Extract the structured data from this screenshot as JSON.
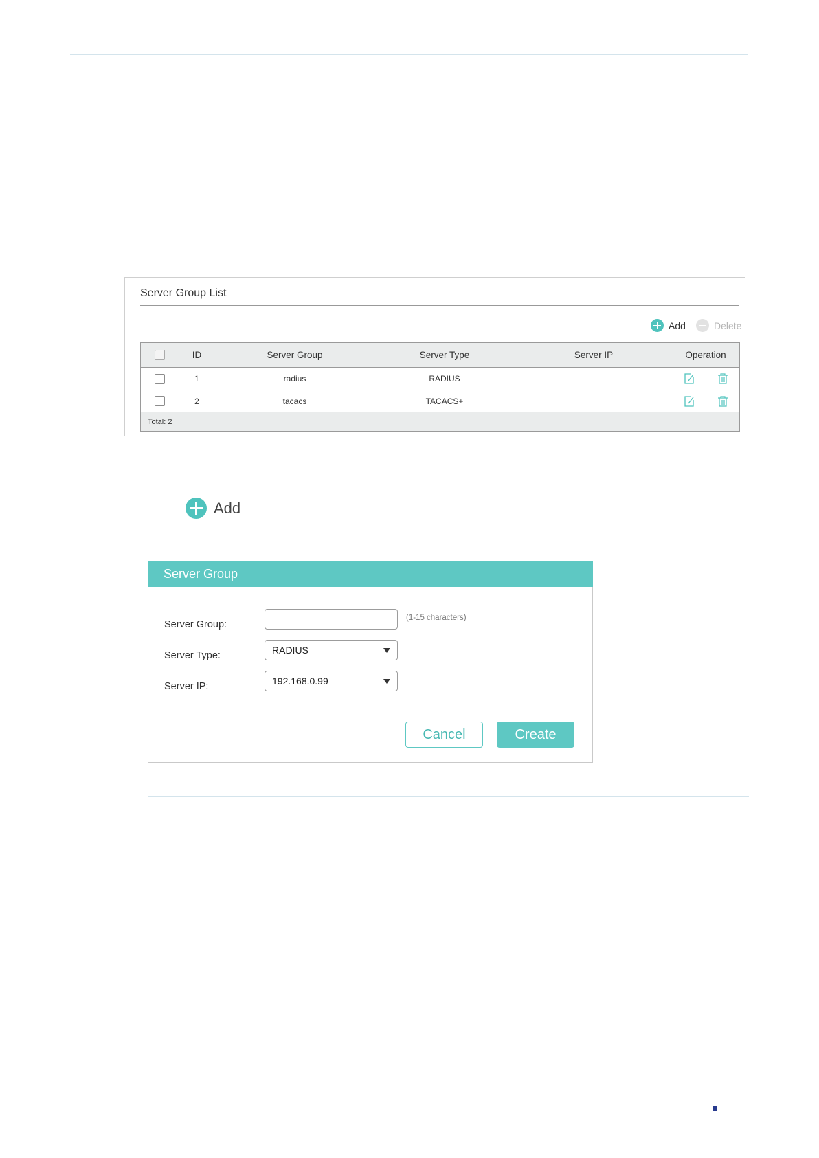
{
  "server_group_list": {
    "title": "Server Group List",
    "add_label": "Add",
    "delete_label": "Delete",
    "columns": [
      "ID",
      "Server Group",
      "Server Type",
      "Server IP",
      "Operation"
    ],
    "rows": [
      {
        "id": "1",
        "group": "radius",
        "type": "RADIUS",
        "ip": ""
      },
      {
        "id": "2",
        "group": "tacacs",
        "type": "TACACS+",
        "ip": ""
      }
    ],
    "total": "Total: 2"
  },
  "add_button": {
    "label": "Add"
  },
  "dialog": {
    "title": "Server Group",
    "fields": {
      "group_label": "Server Group:",
      "group_value": "",
      "group_hint": "(1-15 characters)",
      "type_label": "Server Type:",
      "type_value": "RADIUS",
      "ip_label": "Server IP:",
      "ip_value": "192.168.0.99"
    },
    "cancel_label": "Cancel",
    "create_label": "Create"
  },
  "colors": {
    "accent": "#5ec8c3",
    "page_marker": "#283a8e"
  },
  "icons": [
    "plus-circle-icon",
    "minus-circle-icon",
    "edit-icon",
    "trash-icon",
    "dropdown-caret-icon"
  ]
}
